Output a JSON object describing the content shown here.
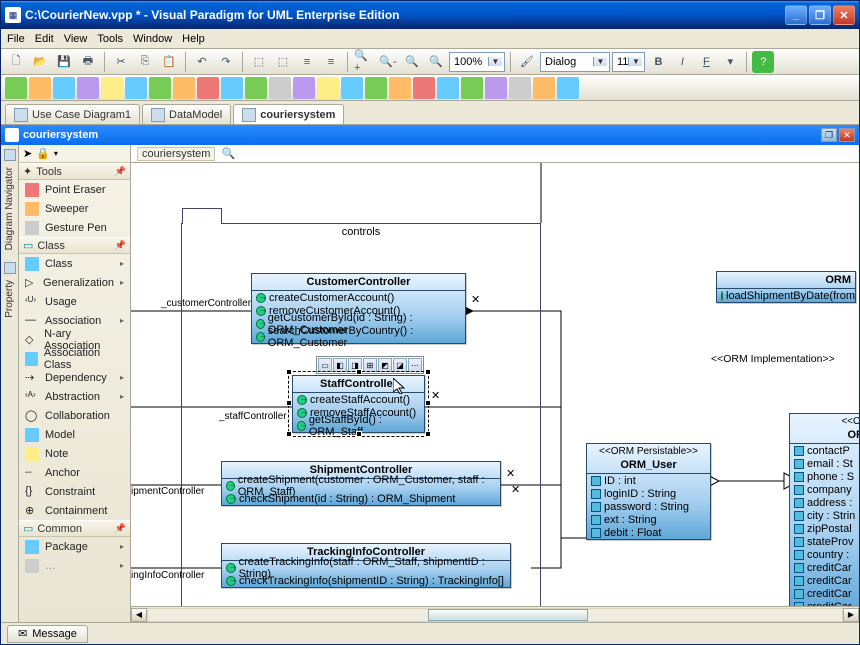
{
  "window": {
    "title": "C:\\CourierNew.vpp * - Visual Paradigm for UML Enterprise Edition"
  },
  "menu": [
    "File",
    "Edit",
    "View",
    "Tools",
    "Window",
    "Help"
  ],
  "zoom": "100%",
  "font_name": "Dialog",
  "font_size": "11",
  "doc_tabs": [
    {
      "label": "Use Case Diagram1",
      "active": false
    },
    {
      "label": "DataModel",
      "active": false
    },
    {
      "label": "couriersystem",
      "active": true
    }
  ],
  "inner_title": "couriersystem",
  "breadcrumb": "couriersystem",
  "side_tabs": [
    "Diagram Navigator",
    "Property"
  ],
  "tools_header": "Tools",
  "tool_groups": {
    "erasers": [
      "Point Eraser",
      "Sweeper",
      "Gesture Pen"
    ],
    "class_hdr": "Class",
    "class_items": [
      "Class",
      "Generalization",
      "Usage",
      "Association",
      "N-ary Association",
      "Association Class",
      "Dependency",
      "Abstraction",
      "Collaboration",
      "Model",
      "Note",
      "Anchor",
      "Constraint",
      "Containment"
    ],
    "common_hdr": "Common",
    "common_items": [
      "Package"
    ]
  },
  "package_label": "controls",
  "classes": {
    "customer": {
      "name": "CustomerController",
      "ops": [
        "createCustomerAccount()",
        "removeCustomerAccount()",
        "getCustomerById(id : String) : ORM_Customer",
        "searchCustomerByCountry() : ORM_Customer"
      ]
    },
    "staff": {
      "name": "StaffController",
      "ops": [
        "createStaffAccount()",
        "removeStaffAccount()",
        "getStaffById() : ORM_Staff"
      ]
    },
    "shipment": {
      "name": "ShipmentController",
      "ops": [
        "createShipment(customer : ORM_Customer, staff : ORM_Staff)",
        "checkShipment(id : String) : ORM_Shipment"
      ]
    },
    "tracking": {
      "name": "TrackingInfoController",
      "ops": [
        "createTrackingInfo(staff : ORM_Staff, shipmentID : String)",
        "checkTrackingInfo(shipmentID : String) : TrackingInfo[]"
      ]
    },
    "orm_user": {
      "stereo": "<<ORM Persistable>>",
      "name": "ORM_User",
      "attrs": [
        "ID : int",
        "loginID : String",
        "password : String",
        "ext : String",
        "debit : Float"
      ]
    },
    "orm_right": {
      "stereo": "<<OR",
      "name": "OR",
      "attrs": [
        "contactP",
        "email : St",
        "phone : S",
        "company",
        "address :",
        "city : Strin",
        "zipPostal",
        "stateProv",
        "country :",
        "creditCar",
        "creditCar",
        "creditCar",
        "creditCar"
      ]
    },
    "orm_top": {
      "name": "ORM",
      "ops": [
        "loadShipmentByDate(from"
      ]
    }
  },
  "anno_impl": "<<ORM Implementation>>",
  "role_labels": {
    "customer": "_customerController",
    "staff": "_staffController",
    "shipment": "ipmentController",
    "tracking": "ingInfoController"
  },
  "status_tab": "Message"
}
